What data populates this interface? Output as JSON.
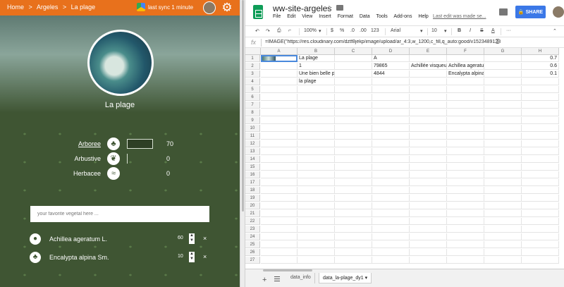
{
  "left_app": {
    "breadcrumb": [
      "Home",
      ">",
      "Argeles",
      ">",
      "La plage"
    ],
    "sync_text": "last sync 1 minute",
    "place_title": "La plage",
    "stats": [
      {
        "label": "Arboree",
        "icon": "tree-icon",
        "value": "70",
        "bar": "filled"
      },
      {
        "label": "Arbustive",
        "icon": "shrub-icon",
        "value": "0",
        "bar": "empty"
      },
      {
        "label": "Herbacee",
        "icon": "grass-icon",
        "value": "0",
        "bar": "none"
      }
    ],
    "search_placeholder": "your favorite vegetal here ...",
    "plants": [
      {
        "name": "Achillea ageratum L.",
        "value": "60",
        "icon": "drop-plant-icon"
      },
      {
        "name": "Encalypta alpina Sm.",
        "value": "10",
        "icon": "tree-icon"
      }
    ],
    "remove_glyph": "×",
    "stepper_up": "▲",
    "stepper_down": "▼",
    "colors": {
      "topbar": "#e8711c",
      "panel": "#3f5533"
    }
  },
  "sheets": {
    "title": "ww-site-argeles",
    "menu": [
      "File",
      "Edit",
      "View",
      "Insert",
      "Format",
      "Data",
      "Tools",
      "Add-ons",
      "Help"
    ],
    "last_edit": "Last edit was made se...",
    "share_label": "SHARE",
    "toolbar": {
      "zoom": "100%",
      "currency": "$",
      "percent": "%",
      "dec_less": ".0",
      "dec_more": ".00",
      "numfmt": "123",
      "font": "Arial",
      "size": "10",
      "bold": "B",
      "italic": "I",
      "strike": "S",
      "textcolor": "A",
      "more": "···"
    },
    "fx_label": "fx",
    "formula": "=IMAGE(\"https://res.cloudinary.com/dztf8jekp/image/upload/ar_4:3,w_1200,c_fill,q_auto:good/v1523489128",
    "columns": [
      "A",
      "B",
      "C",
      "D",
      "E",
      "F",
      "G",
      "H"
    ],
    "rows": [
      [
        "",
        "La plage",
        "",
        "A",
        "",
        "",
        "",
        "0.7"
      ],
      [
        "",
        "1",
        "",
        "79865",
        "Achillée visqueu",
        "Achillea ageratum h",
        "",
        "0.6"
      ],
      [
        "",
        "Une bien belle plage",
        "",
        "4844",
        "",
        "Encalypta alpina Sm.",
        "",
        "0.1"
      ],
      [
        "",
        "la plage",
        "",
        "",
        "",
        "",
        "",
        ""
      ]
    ],
    "row_numbers": [
      "1",
      "2",
      "3",
      "4",
      "5",
      "6",
      "7",
      "8",
      "9",
      "10",
      "11",
      "12",
      "13",
      "14",
      "15",
      "16",
      "17",
      "18",
      "19",
      "20",
      "21",
      "22",
      "23",
      "24",
      "25",
      "26",
      "27"
    ],
    "tabs": [
      "data_info",
      "data_la-plage_dy1"
    ],
    "add_sheet": "+",
    "tab_dropdown": "▾"
  }
}
